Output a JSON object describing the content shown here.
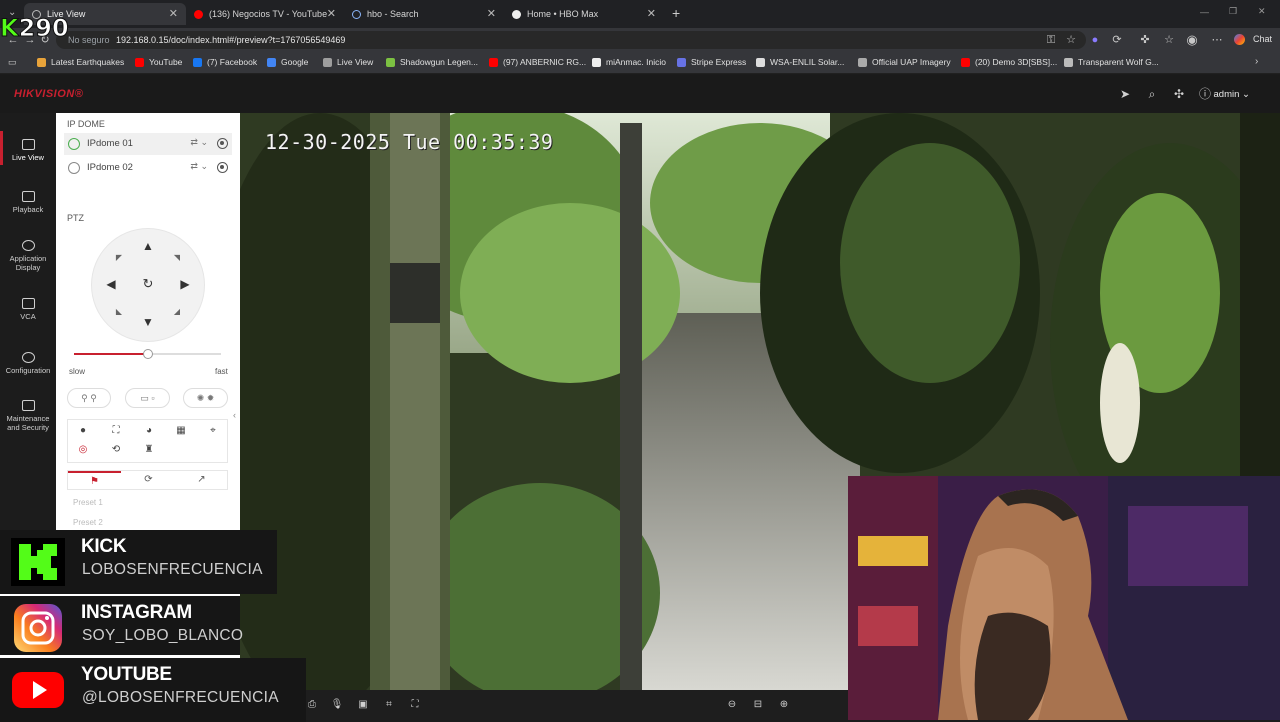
{
  "browser": {
    "tabs": [
      {
        "title": "Live View",
        "active": true
      },
      {
        "title": "(136) Negocios TV - YouTube"
      },
      {
        "title": "hbo - Search"
      },
      {
        "title": "Home • HBO Max"
      }
    ],
    "new_tab": "+",
    "address": {
      "secure_label": "No seguro",
      "url": "192.168.0.15/doc/index.html#/preview?t=1767056549469"
    },
    "chat_label": "Chat",
    "bookmarks": [
      {
        "label": "Latest Earthquakes",
        "color": "#e8a33a"
      },
      {
        "label": "YouTube",
        "color": "#ff0000"
      },
      {
        "label": "(7) Facebook",
        "color": "#1877f2"
      },
      {
        "label": "Google",
        "color": "#4285f4"
      },
      {
        "label": "Live View",
        "color": "#9e9e9e"
      },
      {
        "label": "Shadowgun Legen...",
        "color": "#7cc142"
      },
      {
        "label": "(97) ANBERNIC RG...",
        "color": "#ff0000"
      },
      {
        "label": "miAnmac. Inicio",
        "color": "#eeeeee"
      },
      {
        "label": "Stripe Express",
        "color": "#6772e5"
      },
      {
        "label": "WSA-ENLIL Solar...",
        "color": "#dddddd"
      },
      {
        "label": "Official UAP Imagery",
        "color": "#aaaaaa"
      },
      {
        "label": "(20) Demo 3D[SBS]...",
        "color": "#ff0000"
      },
      {
        "label": "Transparent Wolf G...",
        "color": "#bbbbbb"
      }
    ]
  },
  "app": {
    "logo": "HIKVISION®",
    "user": "admin",
    "brand_color": "#c8202f"
  },
  "nav": [
    {
      "label": "Live View",
      "active": true
    },
    {
      "label": "Playback"
    },
    {
      "label": "Application Display"
    },
    {
      "label": "VCA"
    },
    {
      "label": "Configuration"
    },
    {
      "label": "Maintenance and Security"
    }
  ],
  "panel": {
    "section_title": "IP DOME",
    "cameras": [
      "IPdome 01",
      "IPdome 02"
    ],
    "ptz_title": "PTZ",
    "speed_min": "slow",
    "speed_max": "fast",
    "speed_fraction": 0.5,
    "presets": [
      "Preset 1",
      "Preset 2"
    ]
  },
  "video": {
    "osd": "12-30-2025 Tue 00:35:39"
  },
  "stream_overlay": {
    "counter": "290",
    "counter_k": "K",
    "socials": [
      {
        "name": "KICK",
        "handle": "LOBOSENFRECUENCIA",
        "color": "#53fc18"
      },
      {
        "name": "INSTAGRAM",
        "handle": "SOY_LOBO_BLANCO",
        "color": "#e1306c"
      },
      {
        "name": "YOUTUBE",
        "handle": "@LOBOSENFRECUENCIA",
        "color": "#ff0000"
      }
    ]
  }
}
